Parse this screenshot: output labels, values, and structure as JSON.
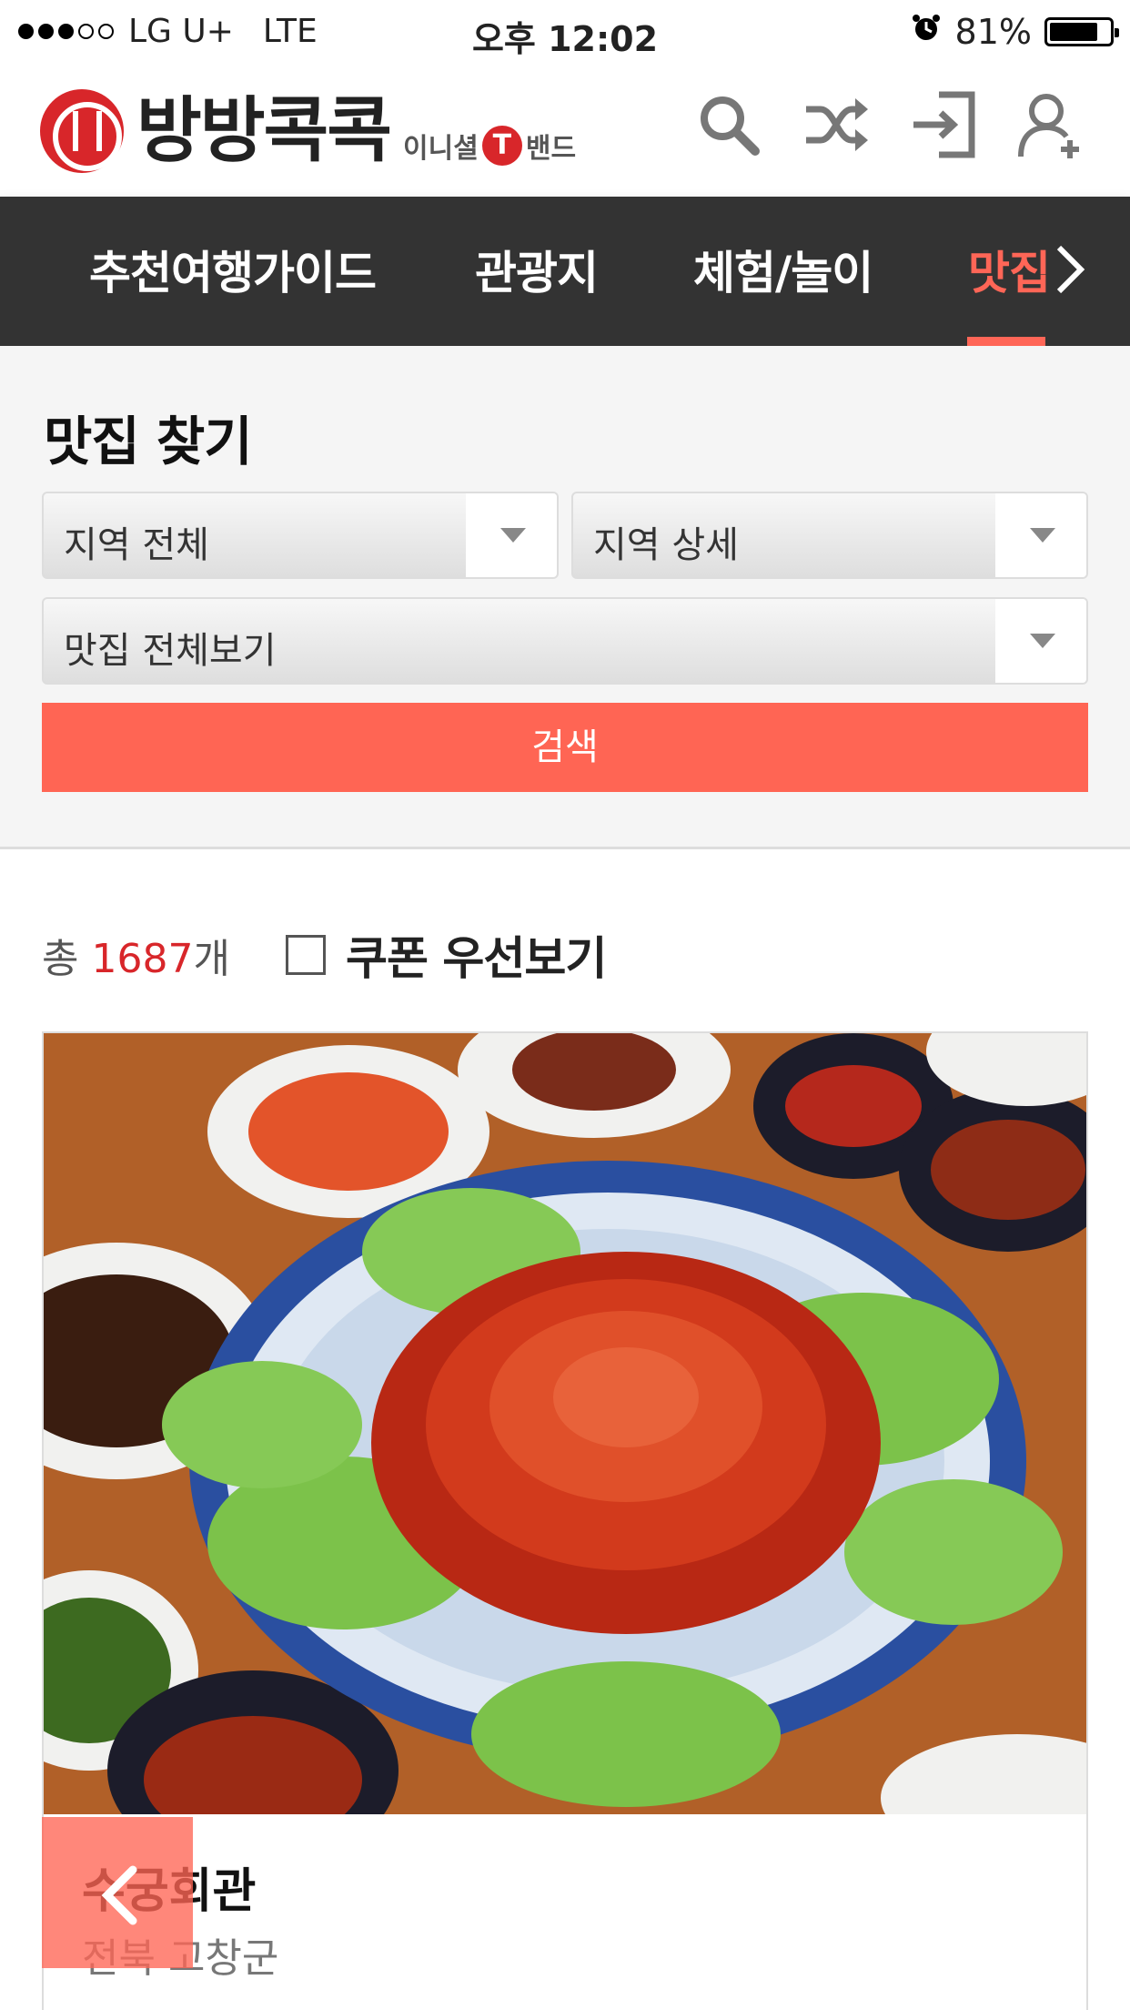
{
  "status_bar": {
    "carrier": "LG U+",
    "network": "LTE",
    "time": "오후 12:02",
    "battery": "81%",
    "battery_level": 0.81
  },
  "header": {
    "logo_text": "방방콕콕",
    "logo_sub_left": "이니셜",
    "logo_t": "T",
    "logo_sub_right": "밴드",
    "icons": [
      "search-icon",
      "shuffle-icon",
      "login-icon",
      "add-user-icon"
    ]
  },
  "nav": {
    "items": [
      {
        "label": "추천여행가이드"
      },
      {
        "label": "관광지"
      },
      {
        "label": "체험/놀이"
      },
      {
        "label": "맛집",
        "active": true
      }
    ]
  },
  "search": {
    "title": "맛집 찾기",
    "region_select": "지역 전체",
    "region_detail_select": "지역 상세",
    "category_select": "맛집 전체보기",
    "button_label": "검색"
  },
  "results": {
    "total_prefix": "총",
    "total_count": "1687",
    "total_suffix": "개",
    "coupon_label": "쿠폰 우선보기"
  },
  "card": {
    "title": "수궁회관",
    "location": "전북 고창군"
  },
  "colors": {
    "accent": "#ff6554",
    "nav_bg": "#333333",
    "logo_red": "#d8262a"
  }
}
